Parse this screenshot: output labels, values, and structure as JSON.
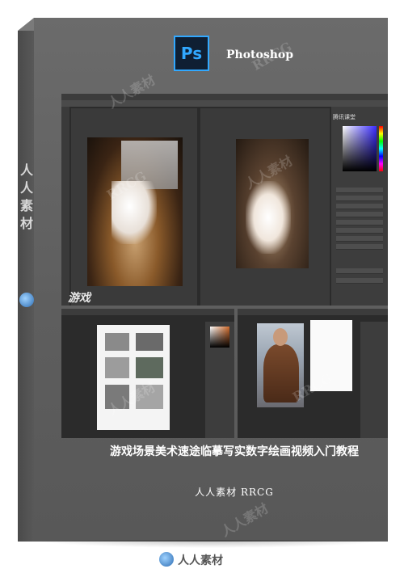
{
  "box": {
    "app_name": "Photoshop",
    "app_icon_text": "Ps",
    "spine_text": "人人素材",
    "title": "游戏场景美术速途临摹写实数字绘画视频入门教程",
    "subtitle": "人人素材 RRCG",
    "watermarks": [
      "人人素材",
      "RRCG"
    ],
    "accent_color": "#31a8ff"
  },
  "screenshots": {
    "top": {
      "canvas_label": "游戏",
      "badge": "腾讯课堂"
    }
  },
  "footer": {
    "brand_text": "人人素材",
    "logo_icon": "rrcg-logo-icon"
  }
}
